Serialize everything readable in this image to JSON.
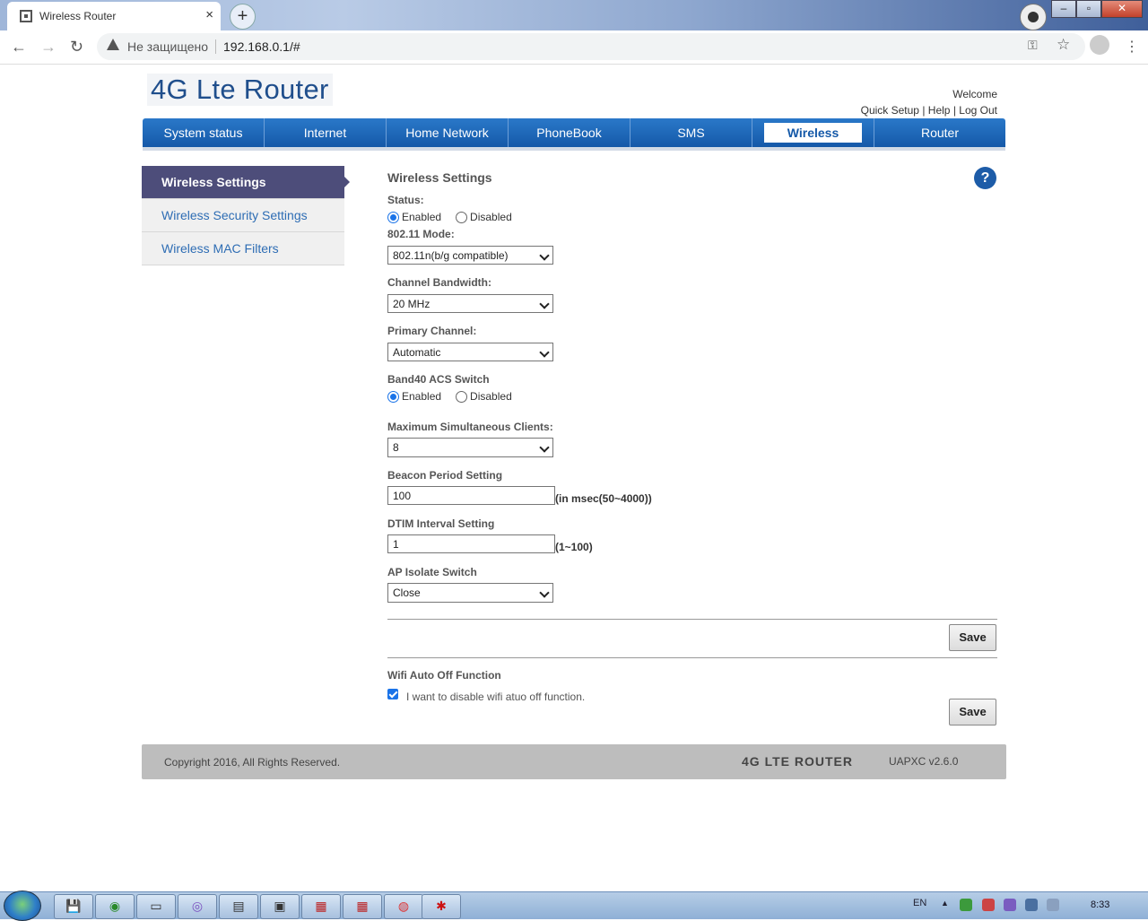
{
  "browser": {
    "tab_title": "Wireless Router",
    "close_glyph": "×",
    "newtab_glyph": "+",
    "security_text": "Не защищено",
    "url": "192.168.0.1/#",
    "icons": [
      "back-icon",
      "forward-icon",
      "reload-icon",
      "warning-icon",
      "key-icon",
      "star-icon",
      "account-icon",
      "menu-icon"
    ]
  },
  "header": {
    "logo": "4G Lte Router",
    "welcome": "Welcome",
    "links": {
      "quick_setup": "Quick Setup",
      "sep1": "|",
      "help": "Help",
      "sep2": "|",
      "logout": "Log Out"
    }
  },
  "nav": {
    "items": [
      {
        "label": "System status"
      },
      {
        "label": "Internet"
      },
      {
        "label": "Home Network"
      },
      {
        "label": "PhoneBook"
      },
      {
        "label": "SMS"
      },
      {
        "label": "Wireless"
      },
      {
        "label": "Router"
      }
    ],
    "active_index": 5
  },
  "sidebar": {
    "items": [
      {
        "label": "Wireless Settings"
      },
      {
        "label": "Wireless Security Settings"
      },
      {
        "label": "Wireless MAC Filters"
      }
    ],
    "active_index": 0
  },
  "form": {
    "title": "Wireless Settings",
    "help_glyph": "?",
    "status": {
      "label": "Status:",
      "enabled": "Enabled",
      "disabled": "Disabled",
      "value": "Enabled"
    },
    "mode": {
      "label": "802.11 Mode:",
      "value": "802.11n(b/g compatible)"
    },
    "bandwidth": {
      "label": "Channel Bandwidth:",
      "value": "20 MHz"
    },
    "channel": {
      "label": "Primary Channel:",
      "value": "Automatic"
    },
    "band40": {
      "label": "Band40 ACS Switch",
      "enabled": "Enabled",
      "disabled": "Disabled",
      "value": "Enabled"
    },
    "clients": {
      "label": "Maximum Simultaneous Clients:",
      "value": "8"
    },
    "beacon": {
      "label": "Beacon Period Setting",
      "value": "100",
      "hint": "(in msec(50~4000))"
    },
    "dtim": {
      "label": "DTIM Interval Setting",
      "value": "1",
      "hint": "(1~100)"
    },
    "isolate": {
      "label": "AP Isolate Switch",
      "value": "Close"
    },
    "save_label": "Save",
    "wifi_auto_off": {
      "title": "Wifi Auto Off Function",
      "checkbox_label": "I want to disable wifi atuo off function.",
      "checked": true
    },
    "save2_label": "Save"
  },
  "footer": {
    "copyright": "Copyright 2016, All Rights Reserved.",
    "brand": "4G LTE ROUTER",
    "version": "UAPXC v2.6.0"
  },
  "taskbar": {
    "lang": "EN",
    "tray_arrow": "▲",
    "time": "8:33"
  },
  "colors": {
    "nav_blue": "#1559a8",
    "sidebar_active": "#4d4d7a",
    "link_blue": "#2e6db4",
    "footer_gray": "#bdbdbd"
  }
}
